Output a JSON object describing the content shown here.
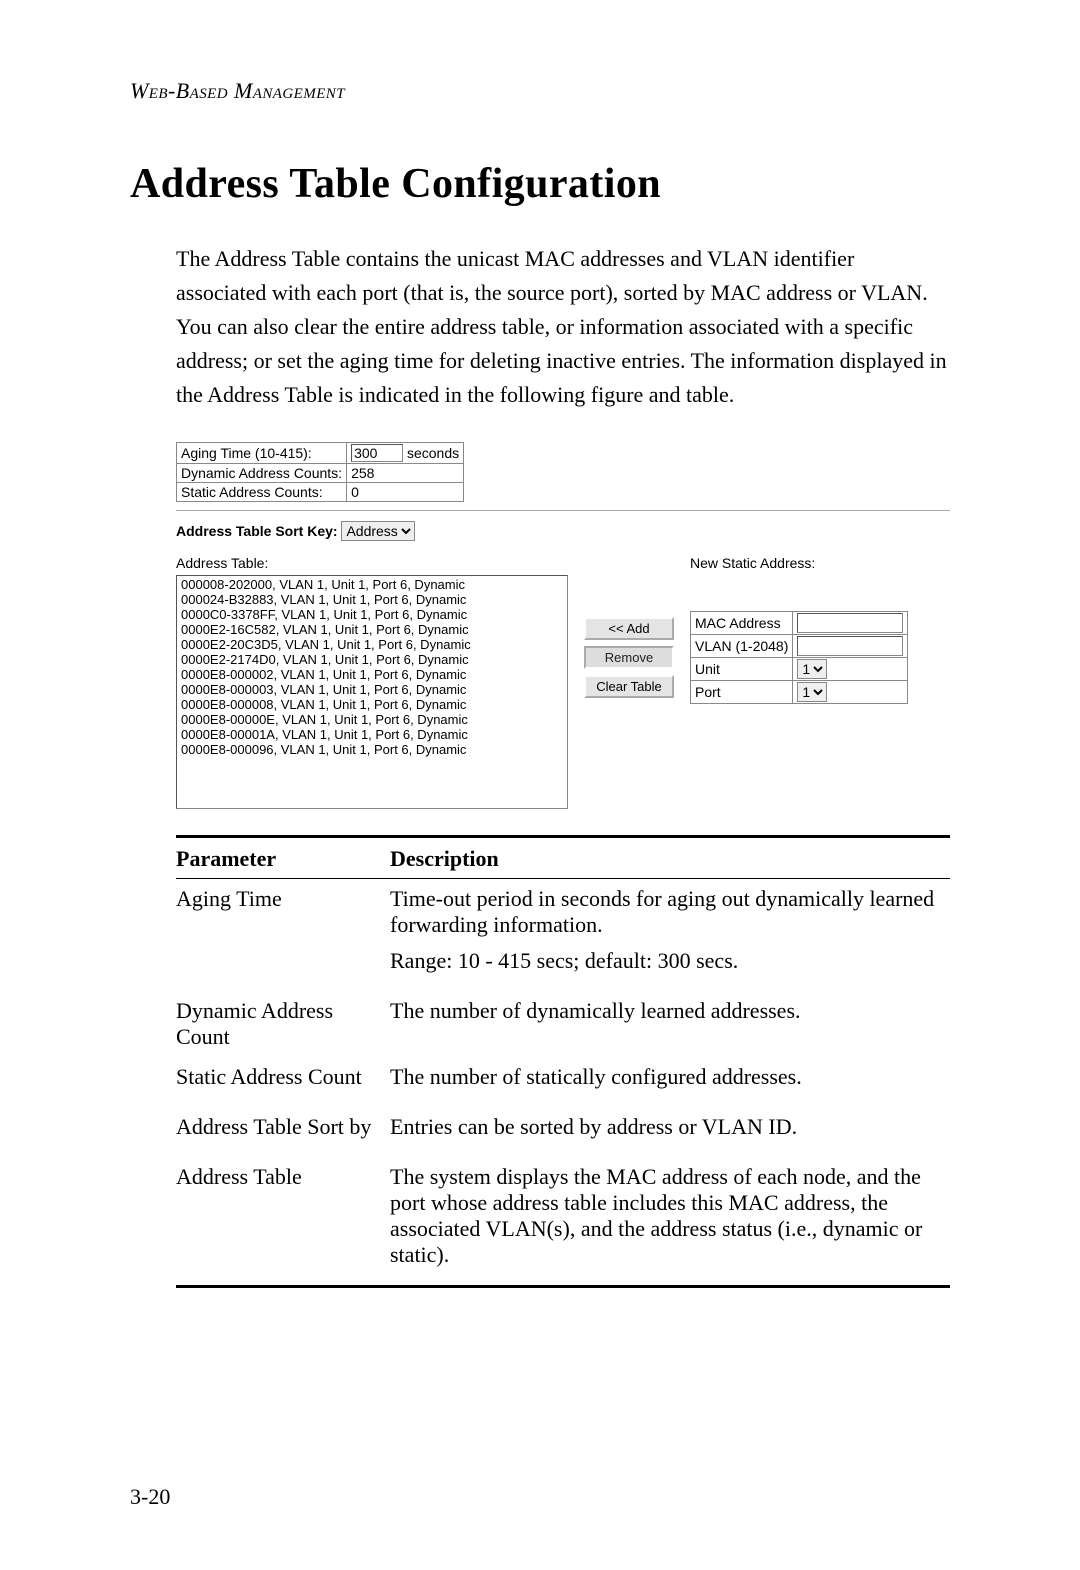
{
  "runningHead": "Web-Based Management",
  "title": "Address Table Configuration",
  "bodyText": "The Address Table contains the unicast MAC addresses and VLAN identifier associated with each port (that is, the source port), sorted by MAC address or VLAN. You can also clear the entire address table, or information associated with a specific address; or set the aging time for deleting inactive entries. The information displayed in the Address Table is indicated in the following figure and table.",
  "figure": {
    "topTable": {
      "agingLabel": "Aging Time (10-415):",
      "agingValue": "300",
      "agingUnits": "seconds",
      "dynCountLabel": "Dynamic Address Counts:",
      "dynCountValue": "258",
      "staticCountLabel": "Static Address Counts:",
      "staticCountValue": "0"
    },
    "sortKeyLabel": "Address Table Sort Key:",
    "sortKeySelected": "Address",
    "addressTableLabel": "Address Table:",
    "addressList": [
      "000008-202000, VLAN 1, Unit 1, Port 6, Dynamic",
      "000024-B32883, VLAN 1, Unit 1, Port 6, Dynamic",
      "0000C0-3378FF, VLAN 1, Unit 1, Port 6, Dynamic",
      "0000E2-16C582, VLAN 1, Unit 1, Port 6, Dynamic",
      "0000E2-20C3D5, VLAN 1, Unit 1, Port 6, Dynamic",
      "0000E2-2174D0, VLAN 1, Unit 1, Port 6, Dynamic",
      "0000E8-000002, VLAN 1, Unit 1, Port 6, Dynamic",
      "0000E8-000003, VLAN 1, Unit 1, Port 6, Dynamic",
      "0000E8-000008, VLAN 1, Unit 1, Port 6, Dynamic",
      "0000E8-00000E, VLAN 1, Unit 1, Port 6, Dynamic",
      "0000E8-00001A, VLAN 1, Unit 1, Port 6, Dynamic",
      "0000E8-000096, VLAN 1, Unit 1, Port 6, Dynamic"
    ],
    "buttons": {
      "add": "<< Add",
      "remove": "Remove",
      "clear": "Clear Table"
    },
    "newStaticLabel": "New Static Address:",
    "newForm": {
      "macLabel": "MAC Address",
      "vlanLabel": "VLAN (1-2048)",
      "unitLabel": "Unit",
      "unitSelected": "1",
      "portLabel": "Port",
      "portSelected": "1"
    }
  },
  "paramTable": {
    "head": {
      "p": "Parameter",
      "d": "Description"
    },
    "rows": [
      {
        "name": "Aging Time",
        "desc": [
          "Time-out period in seconds for aging out dynamically learned forwarding information.",
          "Range: 10 - 415 secs; default: 300 secs."
        ]
      },
      {
        "name": "Dynamic Address Count",
        "desc": [
          "The number of dynamically learned addresses."
        ]
      },
      {
        "name": "Static Address Count",
        "desc": [
          "The number of statically configured addresses."
        ]
      },
      {
        "name": "Address Table Sort by",
        "desc": [
          "Entries can be sorted by address or VLAN ID."
        ]
      },
      {
        "name": "Address Table",
        "desc": [
          "The system displays the MAC address of each node, and the port whose address table includes this MAC address, the associated VLAN(s), and the address status (i.e., dynamic or static)."
        ]
      }
    ]
  },
  "pageNumber": "3-20"
}
